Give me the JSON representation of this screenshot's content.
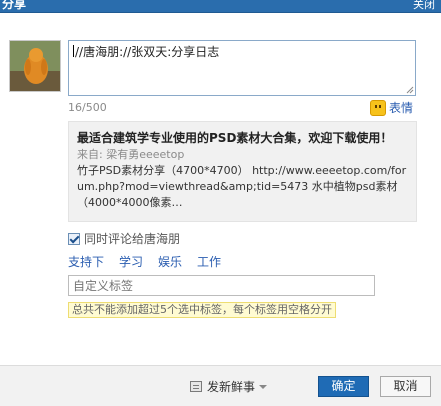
{
  "window": {
    "title": "分享",
    "close_label": "关闭"
  },
  "compose": {
    "text": "//唐海朋://张双天:分享日志",
    "counter": "16/500",
    "emote_label": "表情"
  },
  "quote": {
    "title": "最适合建筑学专业使用的PSD素材大合集，欢迎下载使用！",
    "from": "来自: 梁有勇eeeetop",
    "body": "竹子PSD素材分享（4700*4700） http://www.eeeetop.com/forum.php?mod=viewthread&amp;tid=5473 水中植物psd素材（4000*4000像素…"
  },
  "sync": {
    "label": "同时评论给唐海朋",
    "checked": true
  },
  "tags": [
    "支持下",
    "学习",
    "娱乐",
    "工作"
  ],
  "tag_input": {
    "placeholder": "自定义标签",
    "hint": "总共不能添加超过5个选中标签，每个标签用空格分开"
  },
  "footer": {
    "fresh_label": "发新鲜事",
    "ok_label": "确定",
    "cancel_label": "取消"
  },
  "colors": {
    "titlebar": "#2a6dad",
    "link": "#2a5db0",
    "primary_button": "#1f6bb5"
  }
}
